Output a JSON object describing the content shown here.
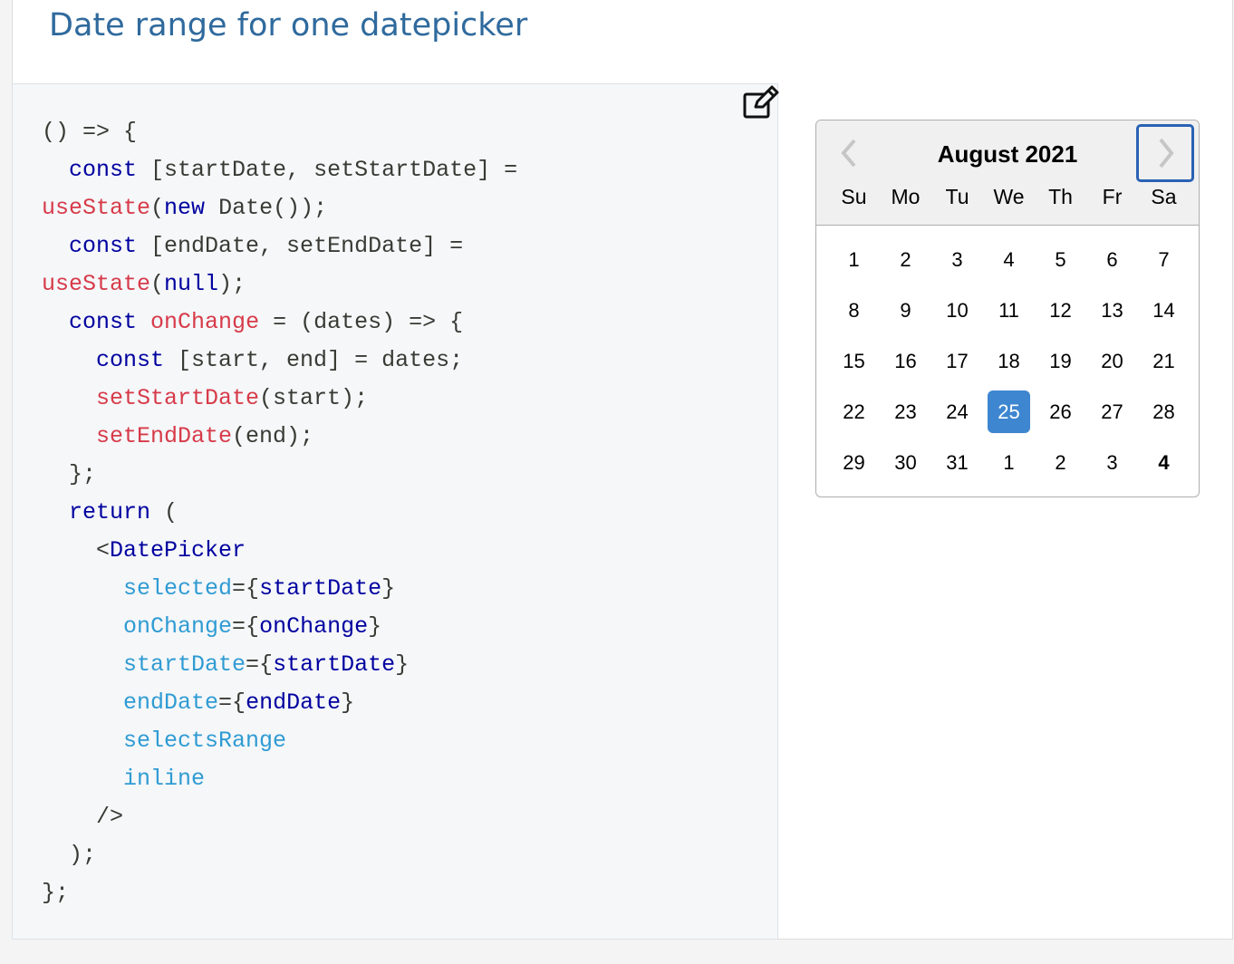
{
  "page": {
    "title": "Date range for one datepicker"
  },
  "editor": {
    "edit_icon": "edit-icon",
    "lines": [
      [
        {
          "t": "() => {",
          "c": "pn"
        }
      ],
      [
        {
          "t": "  ",
          "c": "pn"
        },
        {
          "t": "const",
          "c": "kw"
        },
        {
          "t": " [startDate, setStartDate] =",
          "c": "pn"
        }
      ],
      [
        {
          "t": "useState",
          "c": "fn"
        },
        {
          "t": "(",
          "c": "pn"
        },
        {
          "t": "new",
          "c": "kw"
        },
        {
          "t": " Date());",
          "c": "pn"
        }
      ],
      [
        {
          "t": "  ",
          "c": "pn"
        },
        {
          "t": "const",
          "c": "kw"
        },
        {
          "t": " [endDate, setEndDate] =",
          "c": "pn"
        }
      ],
      [
        {
          "t": "useState",
          "c": "fn"
        },
        {
          "t": "(",
          "c": "pn"
        },
        {
          "t": "null",
          "c": "kw"
        },
        {
          "t": ");",
          "c": "pn"
        }
      ],
      [
        {
          "t": "  ",
          "c": "pn"
        },
        {
          "t": "const",
          "c": "kw"
        },
        {
          "t": " ",
          "c": "pn"
        },
        {
          "t": "onChange",
          "c": "fn"
        },
        {
          "t": " = (dates) => {",
          "c": "pn"
        }
      ],
      [
        {
          "t": "    ",
          "c": "pn"
        },
        {
          "t": "const",
          "c": "kw"
        },
        {
          "t": " [start, end] = dates;",
          "c": "pn"
        }
      ],
      [
        {
          "t": "    ",
          "c": "pn"
        },
        {
          "t": "setStartDate",
          "c": "fn"
        },
        {
          "t": "(start);",
          "c": "pn"
        }
      ],
      [
        {
          "t": "    ",
          "c": "pn"
        },
        {
          "t": "setEndDate",
          "c": "fn"
        },
        {
          "t": "(end);",
          "c": "pn"
        }
      ],
      [
        {
          "t": "  };",
          "c": "pn"
        }
      ],
      [
        {
          "t": "  ",
          "c": "pn"
        },
        {
          "t": "return",
          "c": "kw"
        },
        {
          "t": " (",
          "c": "pn"
        }
      ],
      [
        {
          "t": "    <",
          "c": "pn"
        },
        {
          "t": "DatePicker",
          "c": "tag"
        }
      ],
      [
        {
          "t": "      ",
          "c": "pn"
        },
        {
          "t": "selected",
          "c": "attr"
        },
        {
          "t": "={",
          "c": "pn"
        },
        {
          "t": "startDate",
          "c": "kw"
        },
        {
          "t": "}",
          "c": "pn"
        }
      ],
      [
        {
          "t": "      ",
          "c": "pn"
        },
        {
          "t": "onChange",
          "c": "attr"
        },
        {
          "t": "={",
          "c": "pn"
        },
        {
          "t": "onChange",
          "c": "kw"
        },
        {
          "t": "}",
          "c": "pn"
        }
      ],
      [
        {
          "t": "      ",
          "c": "pn"
        },
        {
          "t": "startDate",
          "c": "attr"
        },
        {
          "t": "={",
          "c": "pn"
        },
        {
          "t": "startDate",
          "c": "kw"
        },
        {
          "t": "}",
          "c": "pn"
        }
      ],
      [
        {
          "t": "      ",
          "c": "pn"
        },
        {
          "t": "endDate",
          "c": "attr"
        },
        {
          "t": "={",
          "c": "pn"
        },
        {
          "t": "endDate",
          "c": "kw"
        },
        {
          "t": "}",
          "c": "pn"
        }
      ],
      [
        {
          "t": "      ",
          "c": "pn"
        },
        {
          "t": "selectsRange",
          "c": "attr"
        }
      ],
      [
        {
          "t": "      ",
          "c": "pn"
        },
        {
          "t": "inline",
          "c": "attr"
        }
      ],
      [
        {
          "t": "    />",
          "c": "pn"
        }
      ],
      [
        {
          "t": "  );",
          "c": "pn"
        }
      ],
      [
        {
          "t": "};",
          "c": "pn"
        }
      ]
    ]
  },
  "datepicker": {
    "month_label": "August 2021",
    "prev_icon": "chevron-left-icon",
    "next_icon": "chevron-right-icon",
    "weekdays": [
      "Su",
      "Mo",
      "Tu",
      "We",
      "Th",
      "Fr",
      "Sa"
    ],
    "weeks": [
      [
        {
          "d": "1"
        },
        {
          "d": "2"
        },
        {
          "d": "3"
        },
        {
          "d": "4"
        },
        {
          "d": "5"
        },
        {
          "d": "6"
        },
        {
          "d": "7"
        }
      ],
      [
        {
          "d": "8"
        },
        {
          "d": "9"
        },
        {
          "d": "10"
        },
        {
          "d": "11"
        },
        {
          "d": "12"
        },
        {
          "d": "13"
        },
        {
          "d": "14"
        }
      ],
      [
        {
          "d": "15"
        },
        {
          "d": "16"
        },
        {
          "d": "17"
        },
        {
          "d": "18"
        },
        {
          "d": "19"
        },
        {
          "d": "20"
        },
        {
          "d": "21"
        }
      ],
      [
        {
          "d": "22"
        },
        {
          "d": "23"
        },
        {
          "d": "24"
        },
        {
          "d": "25",
          "selected": true
        },
        {
          "d": "26"
        },
        {
          "d": "27"
        },
        {
          "d": "28"
        }
      ],
      [
        {
          "d": "29"
        },
        {
          "d": "30"
        },
        {
          "d": "31"
        },
        {
          "d": "1",
          "outside": true
        },
        {
          "d": "2",
          "outside": true
        },
        {
          "d": "3",
          "outside": true
        },
        {
          "d": "4",
          "outside": true,
          "today": true
        }
      ]
    ],
    "colors": {
      "selected_bg": "#3e86d0",
      "focus_border": "#2a62b4"
    }
  }
}
